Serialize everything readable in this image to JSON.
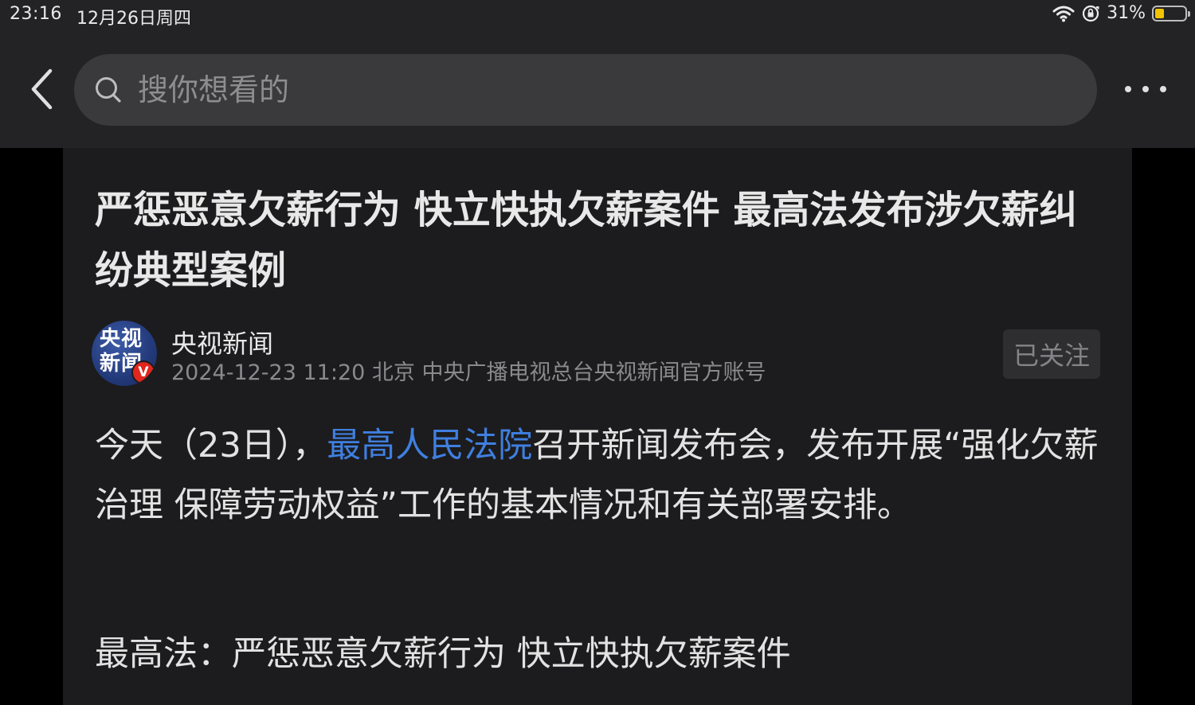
{
  "status_bar": {
    "time": "23:16",
    "date": "12月26日周四",
    "battery_percent": "31%",
    "battery_level": 0.31
  },
  "nav": {
    "search_placeholder": "搜你想看的"
  },
  "article": {
    "headline": "严惩恶意欠薪行为 快立快执欠薪案件 最高法发布涉欠薪纠纷典型案例",
    "author": {
      "avatar_text": "央视新闻",
      "verified_mark": "V",
      "name": "央视新闻",
      "meta": "2024-12-23 11:20 北京  中央广播电视总台央视新闻官方账号"
    },
    "follow_label": "已关注",
    "paragraph": {
      "before_link": "今天（23日），",
      "link_text": "最高人民法院",
      "after_link": "召开新闻发布会，发布开展“强化欠薪治理 保障劳动权益”工作的基本情况和有关部署安排。"
    },
    "subheading": "最高法：严惩恶意欠薪行为 快立快执欠薪案件"
  },
  "colors": {
    "background": "#1c1c1e",
    "topbar": "#232325",
    "link": "#3f7fe0",
    "verified_badge": "#e0261d",
    "battery_fill": "#f2c400"
  },
  "icons": [
    "back-arrow-icon",
    "search-icon",
    "more-icon",
    "wifi-icon",
    "orientation-lock-icon",
    "battery-icon"
  ]
}
